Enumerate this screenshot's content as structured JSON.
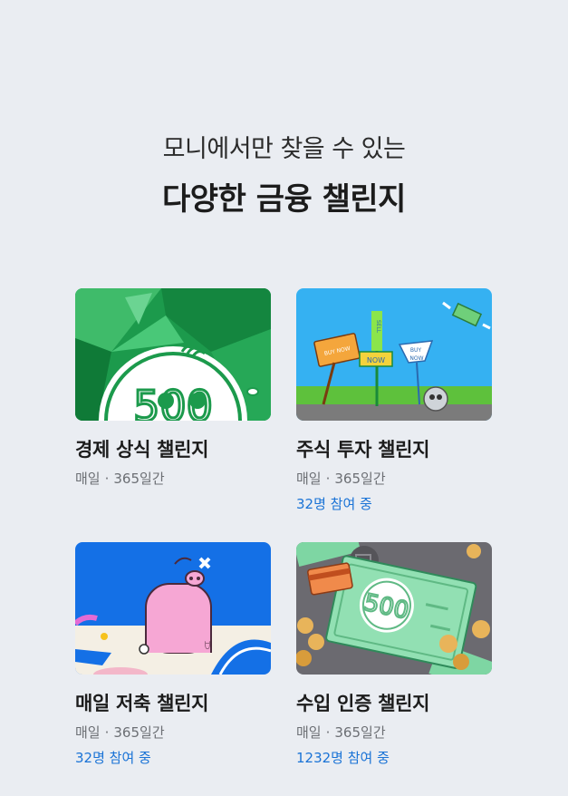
{
  "header": {
    "subtitle": "모니에서만 찾을 수 있는",
    "title": "다양한 금융 챌린지"
  },
  "challenges": [
    {
      "name": "경제 상식 챌린지",
      "frequency": "매일",
      "separator": "·",
      "duration": "365일간",
      "participants": "",
      "theme": "green-coin"
    },
    {
      "name": "주식 투자 챌린지",
      "frequency": "매일",
      "separator": "·",
      "duration": "365일간",
      "participants": "32명 참여 중",
      "theme": "stock-signs"
    },
    {
      "name": "매일 저축 챌린지",
      "frequency": "매일",
      "separator": "·",
      "duration": "365일간",
      "participants": "32명 참여 중",
      "theme": "piggy-bank"
    },
    {
      "name": "수입 인증 챌린지",
      "frequency": "매일",
      "separator": "·",
      "duration": "365일간",
      "participants": "1232명 참여 중",
      "theme": "money-bill"
    }
  ],
  "thumb_text": {
    "coin": "500",
    "buy_now": "BUY NOW",
    "sell": "SELL",
    "now": "NOW",
    "buy": "BUY"
  },
  "colors": {
    "background": "#eaedf2",
    "participants": "#1a73d6",
    "meta": "#6c6f74"
  }
}
